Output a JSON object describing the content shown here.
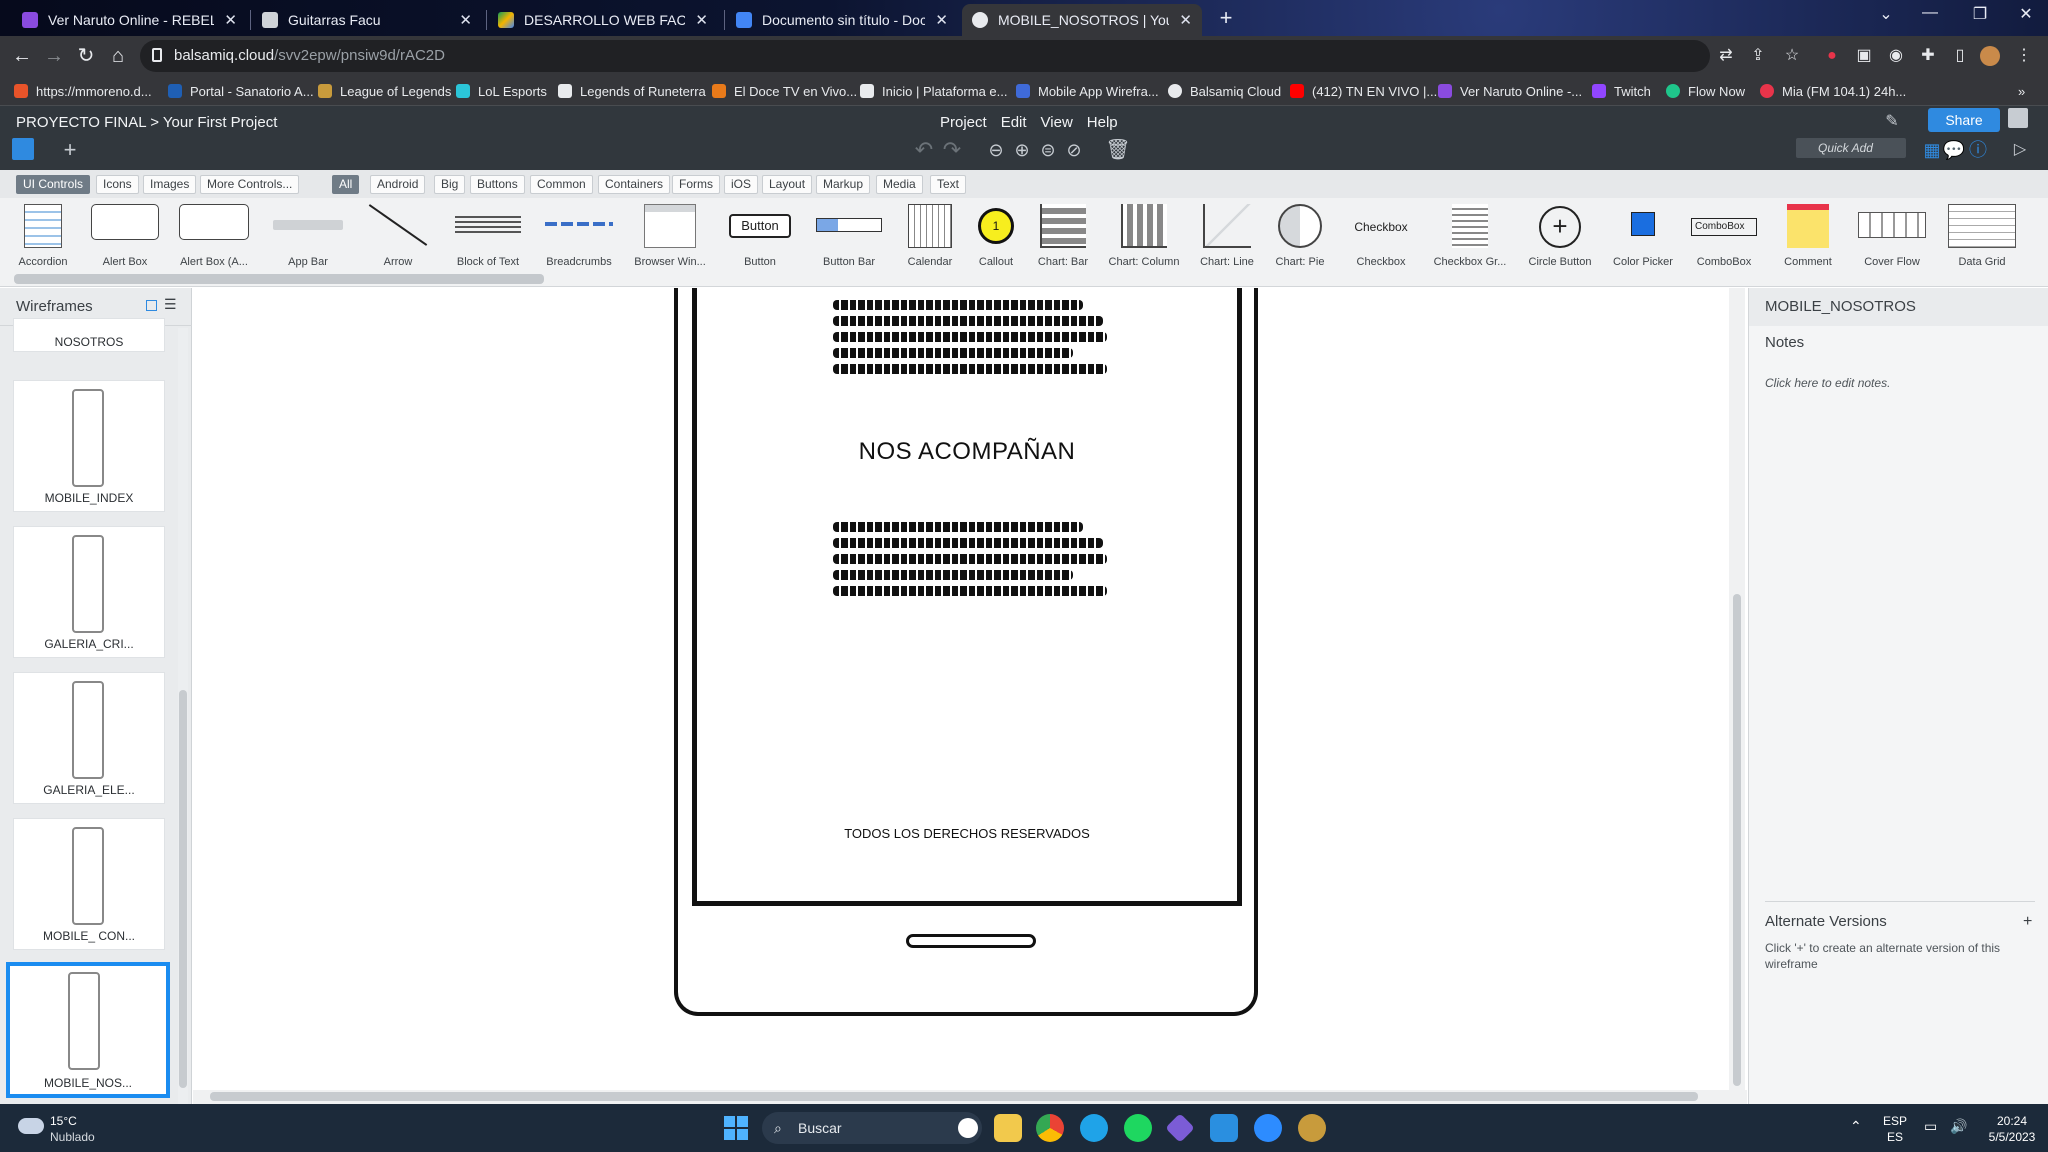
{
  "browser": {
    "tabs": [
      {
        "title": "Ver Naruto Online - REBELISPLUS",
        "color": "#8a4bdf",
        "active": false
      },
      {
        "title": "Guitarras Facu",
        "color": "#cfd3d8",
        "active": false
      },
      {
        "title": "DESARROLLO WEB FACU - Goog",
        "color": "#f4b400",
        "active": false
      },
      {
        "title": "Documento sin título - Documen",
        "color": "#4285f4",
        "active": false
      },
      {
        "title": "MOBILE_NOSOTROS | Your First P",
        "color": "#e8eaed",
        "active": true
      }
    ],
    "new_tab": "+",
    "window_controls": [
      "⌄",
      "—",
      "❐",
      "✕"
    ],
    "address": {
      "host": "balsamiq.cloud",
      "path": "/svv2epw/pnsiw9d/rAC2D"
    },
    "bookmarks": [
      {
        "label": "https://mmoreno.d...",
        "color": "#e8542a"
      },
      {
        "label": "Portal - Sanatorio A...",
        "color": "#1f5fb4"
      },
      {
        "label": "League of Legends",
        "color": "#c89b3c"
      },
      {
        "label": "LoL Esports",
        "color": "#2bc5d8"
      },
      {
        "label": "Legends of Runeterra",
        "color": "#e8eaed"
      },
      {
        "label": "El Doce TV en Vivo...",
        "color": "#e87a1a"
      },
      {
        "label": "Inicio | Plataforma e...",
        "color": "#e8eaed"
      },
      {
        "label": "Mobile App Wirefra...",
        "color": "#3f6ad8"
      },
      {
        "label": "Balsamiq Cloud",
        "color": "#e8eaed"
      },
      {
        "label": "(412) TN EN VIVO |...",
        "color": "#ff0000"
      },
      {
        "label": "Ver Naruto Online -...",
        "color": "#8a4bdf"
      },
      {
        "label": "Twitch",
        "color": "#9146ff"
      },
      {
        "label": "Flow Now",
        "color": "#1fc68b"
      },
      {
        "label": "Mia (FM 104.1) 24h...",
        "color": "#e8344a"
      }
    ]
  },
  "app": {
    "breadcrumb_project": "PROYECTO FINAL",
    "breadcrumb_sep": ">",
    "breadcrumb_file": "Your First Project",
    "menus": [
      "Project",
      "Edit",
      "View",
      "Help"
    ],
    "share_label": "Share",
    "quick_add_placeholder": "Quick Add"
  },
  "filters": {
    "tabs": [
      "UI Controls",
      "Icons",
      "Images",
      "More Controls..."
    ],
    "categories": [
      "All",
      "Android",
      "Big",
      "Buttons",
      "Common",
      "Containers",
      "Forms",
      "iOS",
      "Layout",
      "Markup",
      "Media",
      "Text"
    ]
  },
  "controls": [
    "Accordion",
    "Alert Box",
    "Alert Box (A...",
    "App Bar",
    "Arrow",
    "Block of Text",
    "Breadcrumbs",
    "Browser Win...",
    "Button",
    "Button Bar",
    "Calendar",
    "Callout",
    "Chart: Bar",
    "Chart: Column",
    "Chart: Line",
    "Chart: Pie",
    "Checkbox",
    "Checkbox Gr...",
    "Circle Button",
    "Color Picker",
    "ComboBox",
    "Comment",
    "Cover Flow",
    "Data Grid"
  ],
  "control_samples": {
    "button": "Button",
    "checkbox": "Checkbox",
    "combobox": "ComboBox",
    "callout": "1"
  },
  "wireframes": {
    "title": "Wireframes",
    "items": [
      "NOSOTROS",
      "MOBILE_INDEX",
      "GALERIA_CRI...",
      "GALERIA_ELE...",
      "MOBILE_ CON...",
      "MOBILE_NOS..."
    ]
  },
  "canvas": {
    "heading": "NOS ACOMPAÑAN",
    "footer": "TODOS LOS DERECHOS RESERVADOS"
  },
  "inspector": {
    "title": "MOBILE_NOSOTROS",
    "notes_label": "Notes",
    "notes_placeholder": "Click here to edit notes.",
    "alt_versions_label": "Alternate Versions",
    "alt_plus": "+",
    "alt_desc": "Click '+' to create an alternate version of this wireframe"
  },
  "taskbar": {
    "temp": "15°C",
    "weather": "Nublado",
    "search_placeholder": "Buscar",
    "lang_top": "ESP",
    "lang_bottom": "ES",
    "time": "20:24",
    "date": "5/5/2023"
  }
}
